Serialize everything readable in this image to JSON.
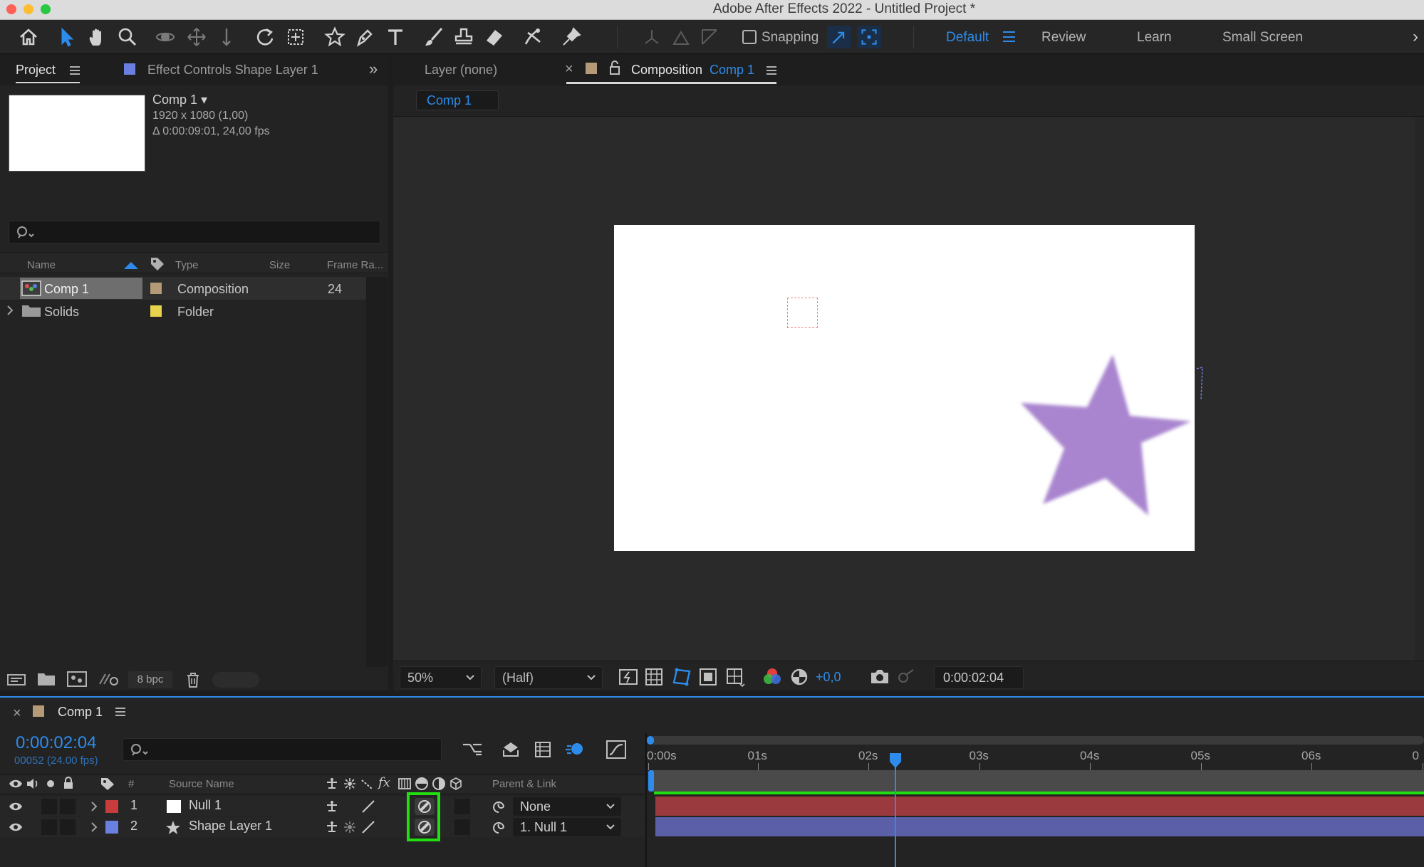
{
  "window": {
    "title": "Adobe After Effects 2022 - Untitled Project *",
    "traffic_lights": [
      "#fe5f57",
      "#febc2e",
      "#28c840"
    ]
  },
  "toolbar": {
    "tools": [
      "home-icon",
      "selection-tool-icon",
      "hand-tool-icon",
      "zoom-tool-icon",
      "orbit-camera-icon",
      "pan-camera-icon",
      "dolly-camera-icon",
      "rotation-tool-icon",
      "pan-behind-icon",
      "star-shape-icon",
      "pen-tool-icon",
      "type-tool-icon",
      "brush-tool-icon",
      "clone-stamp-icon",
      "eraser-icon",
      "roto-brush-icon",
      "puppet-pin-icon"
    ],
    "snapping_label": "Snapping",
    "workspaces": {
      "default": "Default",
      "review": "Review",
      "learn": "Learn",
      "small_screen": "Small Screen"
    },
    "accent": "#2d8ceb"
  },
  "project_panel": {
    "tab_label": "Project",
    "effect_controls_tab": "Effect Controls Shape Layer 1",
    "effect_controls_color": "#6b7fe0",
    "selected_item": {
      "name": "Comp 1 ▾",
      "resolution": "1920 x 1080 (1,00)",
      "duration": "Δ 0:00:09:01, 24,00 fps"
    },
    "search_placeholder": "",
    "columns": {
      "name": "Name",
      "type": "Type",
      "size": "Size",
      "frame_rate": "Frame Ra..."
    },
    "items": [
      {
        "name": "Comp 1",
        "type": "Composition",
        "size": "",
        "frame_rate": "24",
        "label_color": "#b49a77"
      },
      {
        "name": "Solids",
        "type": "Folder",
        "size": "",
        "frame_rate": "",
        "label_color": "#e7d24b"
      }
    ],
    "bit_depth": "8 bpc"
  },
  "viewer": {
    "layer_tab": "Layer (none)",
    "comp_tab_prefix": "Composition",
    "comp_tab_name": "Comp 1",
    "comp_tab_color": "#b49a77",
    "breadcrumb": "Comp 1",
    "star_color": "#a985cf",
    "null_outline_color": "#e88a8a",
    "zoom": "50%",
    "resolution": "(Half)",
    "exposure": "+0,0",
    "timecode": "0:00:02:04"
  },
  "timeline": {
    "comp_name": "Comp 1",
    "comp_color": "#b49a77",
    "current_time": "0:00:02:04",
    "frame_info": "00052 (24.00 fps)",
    "search_placeholder": "",
    "columns": {
      "number": "#",
      "source_name": "Source Name",
      "parent_link": "Parent & Link"
    },
    "ruler_labels": [
      "0:00s",
      "01s",
      "02s",
      "03s",
      "04s",
      "05s",
      "06s",
      "0"
    ],
    "layers": [
      {
        "number": "1",
        "name": "Null 1",
        "label_color": "#c83c3c",
        "parent": "None",
        "bar_color": "#9a3a3f"
      },
      {
        "number": "2",
        "name": "Shape Layer 1",
        "label_color": "#6b7fe0",
        "parent": "1. Null 1",
        "bar_color": "#5a5fa8"
      }
    ],
    "highlight_color": "#22dd11"
  }
}
